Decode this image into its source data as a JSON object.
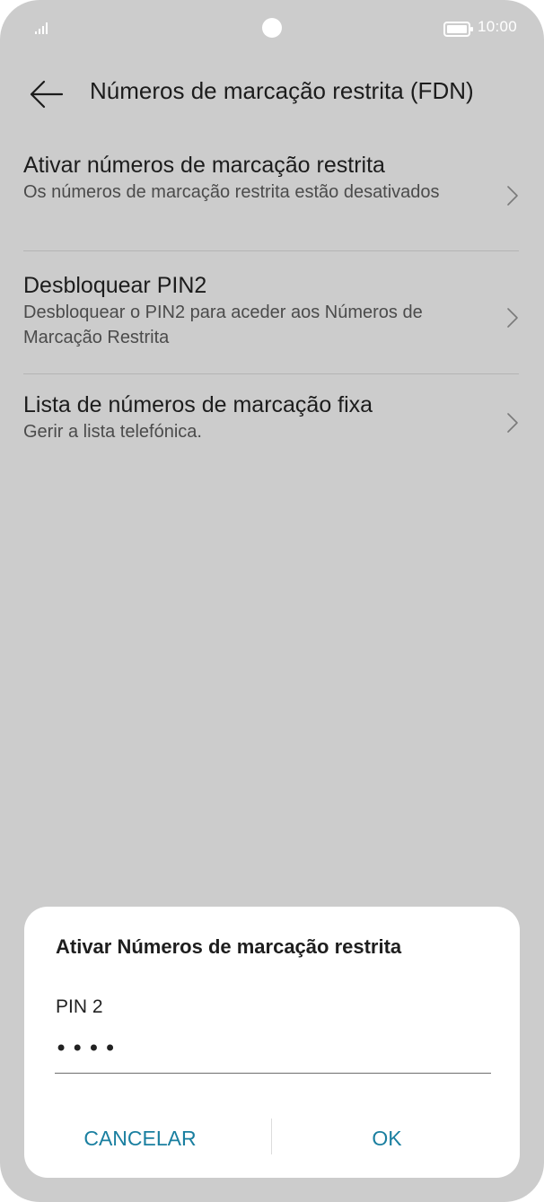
{
  "status_bar": {
    "time": "10:00",
    "icons": [
      "signal-icon",
      "camera-cutout",
      "battery-icon"
    ]
  },
  "header": {
    "title": "Números de marcação restrita (FDN)",
    "back_icon": "back-arrow-icon"
  },
  "list": {
    "items": [
      {
        "title": "Ativar números de marcação restrita",
        "subtitle": "Os números de marcação restrita estão desativados",
        "icon": "chevron-right-icon"
      },
      {
        "title": "Desbloquear PIN2",
        "subtitle": "Desbloquear o PIN2 para aceder aos Números de Marcação Restrita",
        "icon": "chevron-right-icon"
      },
      {
        "title": "Lista de números de marcação fixa",
        "subtitle": "Gerir a lista telefónica.",
        "icon": "chevron-right-icon"
      }
    ]
  },
  "dialog": {
    "title": "Ativar Números de marcação restrita",
    "field_label": "PIN 2",
    "field_value": "••••",
    "cancel_label": "CANCELAR",
    "ok_label": "OK"
  },
  "colors": {
    "background": "#cccccc",
    "dialog_bg": "#ffffff",
    "accent": "#1a7fa0",
    "text_primary": "#1c1c1c",
    "text_secondary": "#4b4b4b"
  }
}
